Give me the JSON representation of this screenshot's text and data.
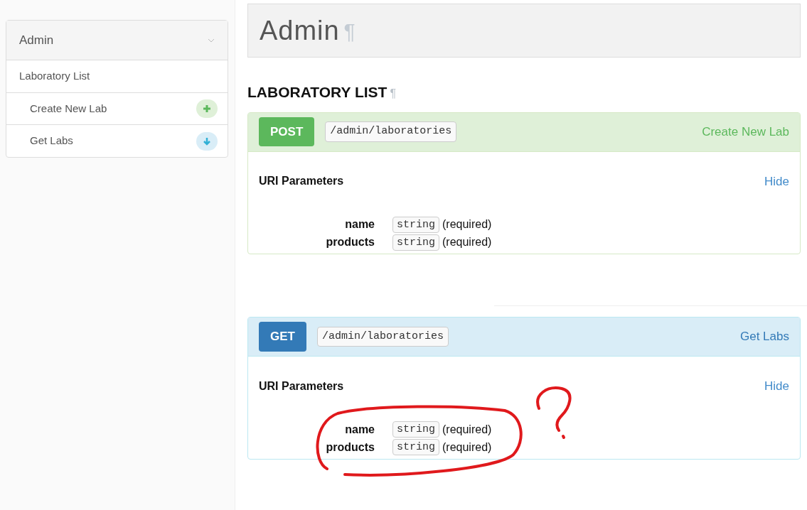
{
  "sidebar": {
    "title": "Admin",
    "section": "Laboratory List",
    "items": [
      {
        "label": "Create New Lab",
        "kind": "post"
      },
      {
        "label": "Get Labs",
        "kind": "get"
      }
    ]
  },
  "page_title": "Admin",
  "page_title_anchor": "¶",
  "section_title": "LABORATORY LIST",
  "section_anchor": "¶",
  "endpoints": [
    {
      "kind": "post",
      "method": "POST",
      "path": "/admin/laboratories",
      "name": "Create New Lab",
      "params_title": "URI Parameters",
      "toggle": "Hide",
      "params": [
        {
          "name": "name",
          "type": "string",
          "note": "(required)"
        },
        {
          "name": "products",
          "type": "string",
          "note": "(required)"
        }
      ]
    },
    {
      "kind": "get",
      "method": "GET",
      "path": "/admin/laboratories",
      "name": "Get Labs",
      "params_title": "URI Parameters",
      "toggle": "Hide",
      "params": [
        {
          "name": "name",
          "type": "string",
          "note": "(required)"
        },
        {
          "name": "products",
          "type": "string",
          "note": "(required)"
        }
      ]
    }
  ]
}
